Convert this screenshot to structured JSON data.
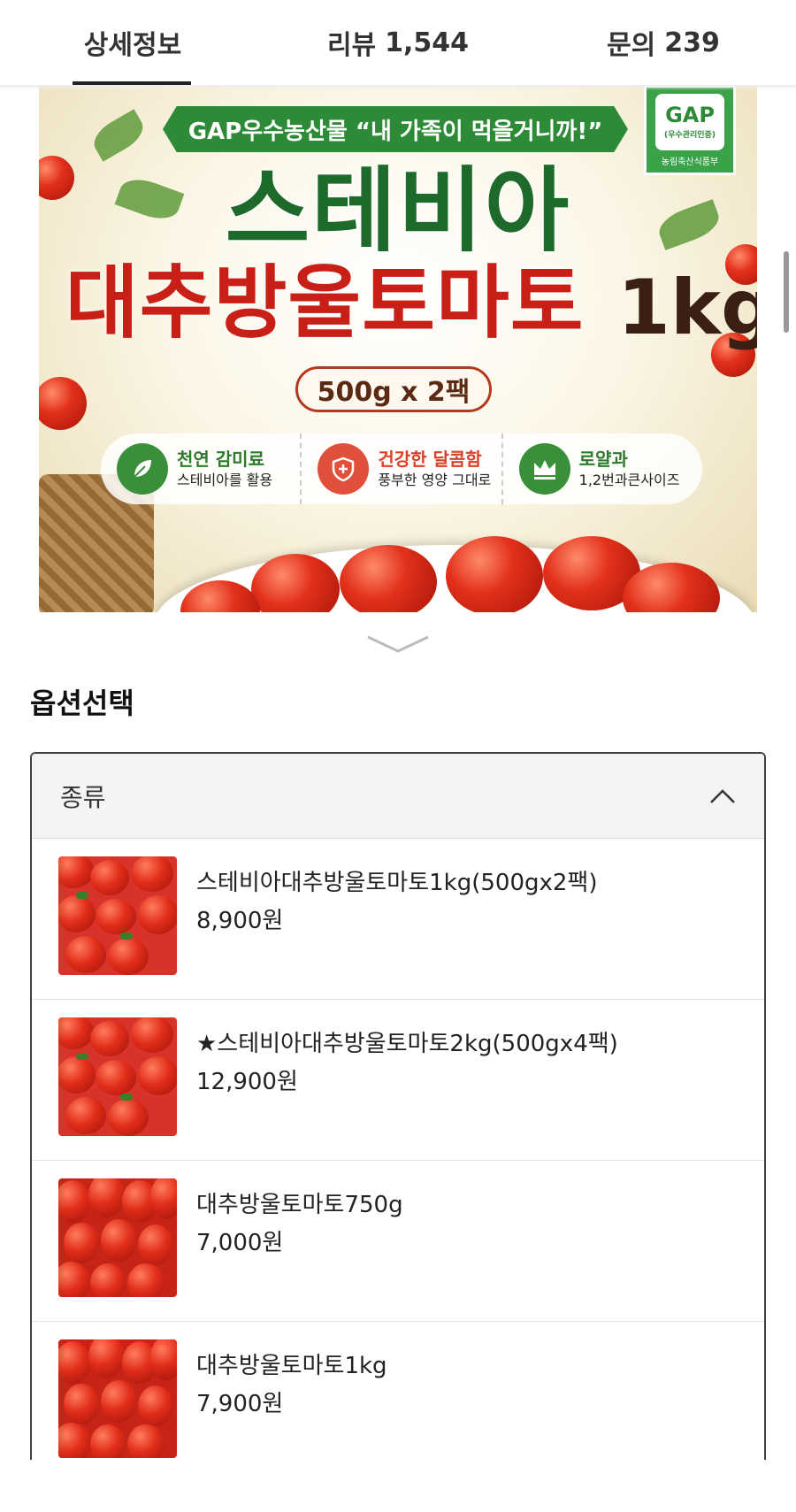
{
  "tabs": [
    {
      "label": "상세정보"
    },
    {
      "label": "리뷰",
      "count": "1,544"
    },
    {
      "label": "문의",
      "count": "239"
    }
  ],
  "banner": {
    "ribbon": "GAP우수농산물 “내 가족이 먹을거니까!”",
    "gap_badge": {
      "title": "GAP",
      "subtitle": "(우수관리인증)",
      "ministry": "농림축산식품부"
    },
    "title_line1": "스테비아",
    "title_line2": "대추방울토마토",
    "weight": "1kg",
    "pack": "500g x 2팩",
    "features": [
      {
        "title": "천연 감미료",
        "sub": "스테비아를 활용",
        "icon": "leaf-icon",
        "color": "#3a8f3a"
      },
      {
        "title": "건강한 달콤함",
        "sub": "풍부한 영양 그대로",
        "icon": "shield-plus-icon",
        "color": "#e0503a"
      },
      {
        "title": "로얄과",
        "sub": "1,2번과큰사이즈",
        "icon": "crown-icon",
        "color": "#3a8f3a"
      }
    ]
  },
  "section_title": "옵션선택",
  "option_panel": {
    "label": "종류",
    "options": [
      {
        "name": "스테비아대추방울토마토1kg(500gx2팩)",
        "price": "8,900원"
      },
      {
        "name": "★스테비아대추방울토마토2kg(500gx4팩)",
        "price": "12,900원"
      },
      {
        "name": "대추방울토마토750g",
        "price": "7,000원"
      },
      {
        "name": "대추방울토마토1kg",
        "price": "7,900원"
      }
    ]
  },
  "colors": {
    "accent_green": "#2d8a36",
    "title_red": "#c81f16",
    "tab_active": "#222222"
  }
}
